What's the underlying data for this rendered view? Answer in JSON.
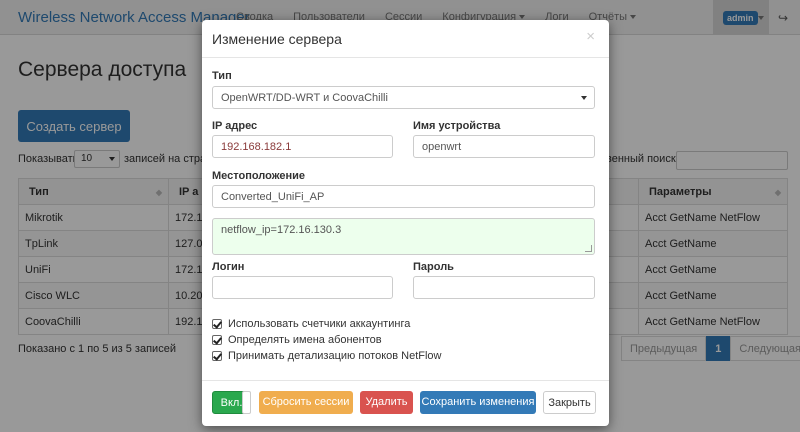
{
  "navbar": {
    "brand": "Wireless Network Access Manager",
    "items": [
      "Сводка",
      "Пользователи",
      "Сессии",
      "Конфигурация",
      "Логи",
      "Отчёты"
    ],
    "user": "admin"
  },
  "page": {
    "title": "Сервера доступа",
    "create_button": "Создать сервер",
    "show_label": "Показывать:",
    "page_size": "10",
    "records_label": "записей на стран",
    "search_label": "венный поиск:",
    "info": "Показано с 1 по 5 из 5 записей",
    "pager": {
      "prev": "Предыдущая",
      "current": "1",
      "next": "Следующая"
    }
  },
  "table": {
    "headers": [
      "Тип",
      "IP а",
      "Параметры"
    ],
    "rows": [
      {
        "type": "Mikrotik",
        "ip": "172.1",
        "params": "Acct GetName NetFlow"
      },
      {
        "type": "TpLink",
        "ip": "127.0",
        "params": "Acct GetName"
      },
      {
        "type": "UniFi",
        "ip": "172.1",
        "params": "Acct GetName"
      },
      {
        "type": "Cisco WLC",
        "ip": "10.20",
        "params": "Acct GetName"
      },
      {
        "type": "CoovaChilli",
        "ip": "192.1",
        "params": "Acct GetName NetFlow"
      }
    ]
  },
  "modal": {
    "title": "Изменение сервера",
    "type_label": "Тип",
    "type_value": "OpenWRT/DD-WRT и CoovaChilli",
    "ip_label": "IP адрес",
    "ip_value": "192.168.182.1",
    "device_label": "Имя устройства",
    "device_value": "openwrt",
    "location_label": "Местоположение",
    "location_value": "Converted_UniFi_AP",
    "notes_value": "netflow_ip=172.16.130.3",
    "login_label": "Логин",
    "login_value": "",
    "password_label": "Пароль",
    "password_value": "",
    "checkboxes": [
      "Использовать счетчики аккаунтинга",
      "Определять имена абонентов",
      "Принимать детализацию потоков NetFlow"
    ],
    "buttons": {
      "toggle": "Вкл.",
      "reset": "Сбросить сессии",
      "delete": "Удалить",
      "save": "Сохранить изменения",
      "close": "Закрыть"
    }
  },
  "colors": {
    "primary": "#337ab7",
    "success": "#2aa84e",
    "warning": "#f0ad4e",
    "danger": "#d9534f"
  }
}
